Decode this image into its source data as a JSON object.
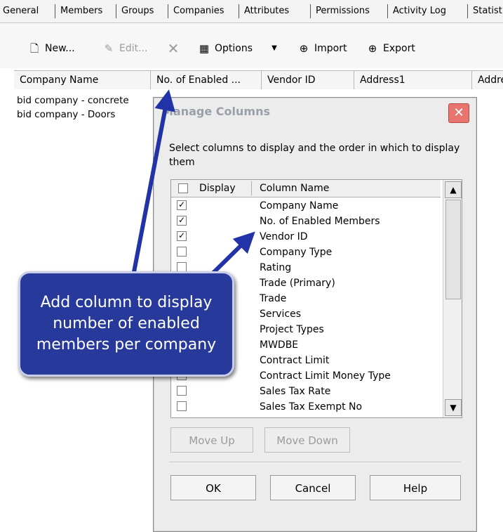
{
  "tabs": [
    {
      "label": "General"
    },
    {
      "label": "Members"
    },
    {
      "label": "Groups"
    },
    {
      "label": "Companies"
    },
    {
      "label": "Attributes"
    },
    {
      "label": "Permissions"
    },
    {
      "label": "Activity Log"
    },
    {
      "label": "Statist"
    }
  ],
  "toolbar": {
    "new_label": "New...",
    "edit_label": "Edit...",
    "options_label": "Options",
    "import_label": "Import",
    "export_label": "Export"
  },
  "grid": {
    "columns": [
      "Company Name",
      "No. of Enabled ...",
      "Vendor ID",
      "Address1",
      "Addre"
    ],
    "rows": [
      "bid company - concrete",
      "bid company - Doors"
    ]
  },
  "dialog": {
    "title": "Manage Columns",
    "description": "Select columns to display and the order in which to display them",
    "header_display": "Display",
    "header_column_name": "Column Name",
    "columns": [
      {
        "name": "Company Name",
        "checked": true
      },
      {
        "name": "No. of Enabled Members",
        "checked": true
      },
      {
        "name": "Vendor ID",
        "checked": true
      },
      {
        "name": "Company Type",
        "checked": false
      },
      {
        "name": "Rating",
        "checked": false
      },
      {
        "name": "Trade (Primary)",
        "checked": false
      },
      {
        "name": "Trade",
        "checked": false
      },
      {
        "name": "Services",
        "checked": false
      },
      {
        "name": "Project Types",
        "checked": false
      },
      {
        "name": "MWDBE",
        "checked": false
      },
      {
        "name": "Contract Limit",
        "checked": false
      },
      {
        "name": "Contract Limit Money Type",
        "checked": false
      },
      {
        "name": "Sales Tax Rate",
        "checked": false
      },
      {
        "name": "Sales Tax Exempt No",
        "checked": false
      }
    ],
    "move_up_label": "Move Up",
    "move_down_label": "Move Down",
    "ok_label": "OK",
    "cancel_label": "Cancel",
    "help_label": "Help"
  },
  "callout": {
    "text": "Add column to display number of enabled members per company"
  },
  "colors": {
    "callout_fill": "#273a9c",
    "arrow": "#2233a8",
    "close_button": "#e7756e"
  }
}
